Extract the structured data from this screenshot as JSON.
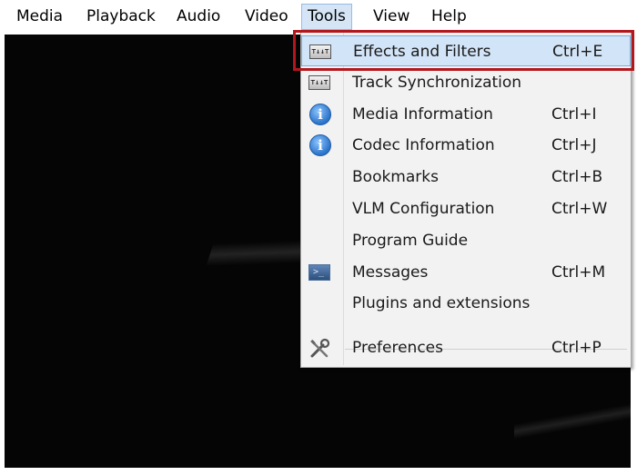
{
  "menubar": {
    "items": [
      "Media",
      "Playback",
      "Audio",
      "Video",
      "Tools",
      "View",
      "Help"
    ],
    "active": "Tools"
  },
  "tools_menu": {
    "items": [
      {
        "label": "Effects and Filters",
        "shortcut": "Ctrl+E",
        "icon": "equalizer-icon",
        "highlighted": true
      },
      {
        "label": "Track Synchronization",
        "shortcut": "",
        "icon": "equalizer-icon"
      },
      {
        "label": "Media Information",
        "shortcut": "Ctrl+I",
        "icon": "info-icon"
      },
      {
        "label": "Codec Information",
        "shortcut": "Ctrl+J",
        "icon": "info-icon"
      },
      {
        "label": "Bookmarks",
        "shortcut": "Ctrl+B",
        "icon": ""
      },
      {
        "label": "VLM Configuration",
        "shortcut": "Ctrl+W",
        "icon": ""
      },
      {
        "label": "Program Guide",
        "shortcut": "",
        "icon": ""
      },
      {
        "label": "Messages",
        "shortcut": "Ctrl+M",
        "icon": "terminal-icon"
      },
      {
        "label": "Plugins and extensions",
        "shortcut": "",
        "icon": ""
      },
      {
        "label": "Preferences",
        "shortcut": "Ctrl+P",
        "icon": "tools-icon"
      }
    ]
  },
  "colors": {
    "highlight": "#d2e4f7",
    "callout_frame": "#b3161c",
    "video_background": "#050505"
  }
}
